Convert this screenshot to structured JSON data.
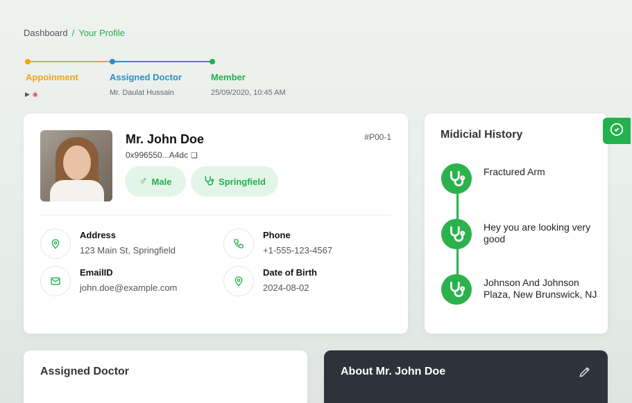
{
  "breadcrumb": {
    "home": "Dashboard",
    "separator": "/",
    "current": "Your Profile"
  },
  "stepper": {
    "steps": [
      {
        "title": "Appoinment",
        "subtitle": "",
        "color": "#f2a516"
      },
      {
        "title": "Assigned Doctor",
        "subtitle": "Mr. Daulat Hussain",
        "color": "#2f8cc4"
      },
      {
        "title": "Member",
        "subtitle": "25/09/2020, 10:45 AM",
        "color": "#22b14c"
      }
    ]
  },
  "profile": {
    "name": "Mr. John Doe",
    "wallet": "0x996550...A4dc",
    "id": "#P00-1",
    "gender": "Male",
    "city": "Springfield",
    "info": [
      {
        "label": "Address",
        "value": "123 Main St, Springfield",
        "icon": "location-pin-icon"
      },
      {
        "label": "Phone",
        "value": "+1-555-123-4567",
        "icon": "phone-icon"
      },
      {
        "label": "EmailID",
        "value": "john.doe@example.com",
        "icon": "mail-icon"
      },
      {
        "label": "Date of Birth",
        "value": "2024-08-02",
        "icon": "location-pin-icon"
      }
    ]
  },
  "history": {
    "title": "Midicial History",
    "items": [
      {
        "text": "Fractured Arm"
      },
      {
        "text": "Hey you are looking very good"
      },
      {
        "text": "Johnson And Johnson Plaza, New Brunswick, NJ"
      }
    ]
  },
  "assigned_doctor": {
    "title": "Assigned Doctor"
  },
  "about": {
    "title": "About Mr. John Doe"
  },
  "colors": {
    "accent": "#22b14c",
    "orange": "#f2a516",
    "blue": "#2f8cc4",
    "dark": "#2d333b"
  }
}
